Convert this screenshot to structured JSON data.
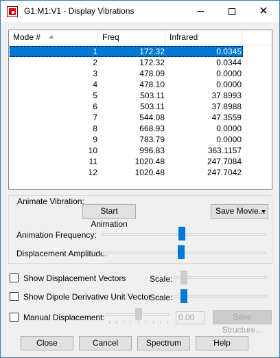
{
  "window": {
    "title": "G1:M1:V1 - Display Vibrations"
  },
  "list": {
    "headers": {
      "mode": "Mode #",
      "freq": "Freq",
      "infrared": "Infrared"
    },
    "rows": [
      {
        "mode": "1",
        "freq": "172.32",
        "ir": "0.0345"
      },
      {
        "mode": "2",
        "freq": "172.32",
        "ir": "0.0344"
      },
      {
        "mode": "3",
        "freq": "478.09",
        "ir": "0.0000"
      },
      {
        "mode": "4",
        "freq": "478.10",
        "ir": "0.0000"
      },
      {
        "mode": "5",
        "freq": "503.11",
        "ir": "37.8993"
      },
      {
        "mode": "6",
        "freq": "503.11",
        "ir": "37.8988"
      },
      {
        "mode": "7",
        "freq": "544.08",
        "ir": "47.3559"
      },
      {
        "mode": "8",
        "freq": "668.93",
        "ir": "0.0000"
      },
      {
        "mode": "9",
        "freq": "783.79",
        "ir": "0.0000"
      },
      {
        "mode": "10",
        "freq": "996.83",
        "ir": "363.1157"
      },
      {
        "mode": "11",
        "freq": "1020.48",
        "ir": "247.7084"
      },
      {
        "mode": "12",
        "freq": "1020.48",
        "ir": "247.7042"
      }
    ]
  },
  "animate": {
    "group_label": "Animate Vibration:",
    "start_button": "Start Animation",
    "save_movie_button": "Save Movie...",
    "frequency_label": "Animation Frequency:",
    "amplitude_label": "Displacement Amplitude:"
  },
  "options": {
    "show_vectors": "Show Displacement Vectors",
    "show_dipole": "Show Dipole Derivative Unit Vector",
    "manual_disp": "Manual Displacement:",
    "scale_label": "Scale:",
    "scale_label2": "Scale:",
    "manual_value": "0.00",
    "save_structure": "Save Structure..."
  },
  "footer": {
    "close": "Close",
    "cancel": "Cancel",
    "spectrum": "Spectrum",
    "help": "Help"
  },
  "colors": {
    "selection": "#0078d7",
    "slider_thumb": "#0078d7"
  }
}
